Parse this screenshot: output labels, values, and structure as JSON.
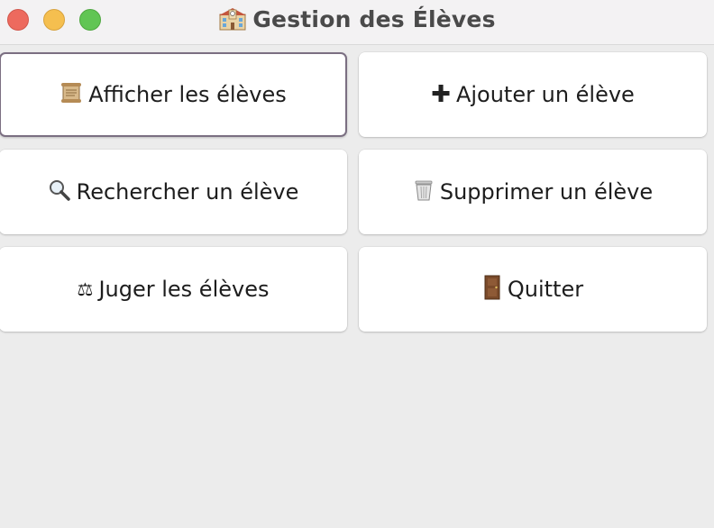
{
  "window": {
    "title": "Gestion des Élèves",
    "title_icon": "school-building-icon"
  },
  "buttons": [
    {
      "label": "Afficher les élèves",
      "icon": "scroll-icon",
      "glyph": "📜",
      "focused": true
    },
    {
      "label": "Ajouter un élève",
      "icon": "plus-icon",
      "glyph": "✚"
    },
    {
      "label": "Rechercher un élève",
      "icon": "magnifier-icon",
      "glyph": "🔍"
    },
    {
      "label": "Supprimer un élève",
      "icon": "trash-icon",
      "glyph": "🗑"
    },
    {
      "label": "Juger les élèves",
      "icon": "scales-icon",
      "glyph": "⚖"
    },
    {
      "label": "Quitter",
      "icon": "door-icon",
      "glyph": "🚪"
    }
  ],
  "colors": {
    "background": "#ececec",
    "titlebar": "#f3f2f3",
    "button": "#ffffff",
    "focus_ring": "#7b6f82",
    "close": "#ed6a5e",
    "minimize": "#f5bf4f",
    "zoom": "#61c554"
  }
}
